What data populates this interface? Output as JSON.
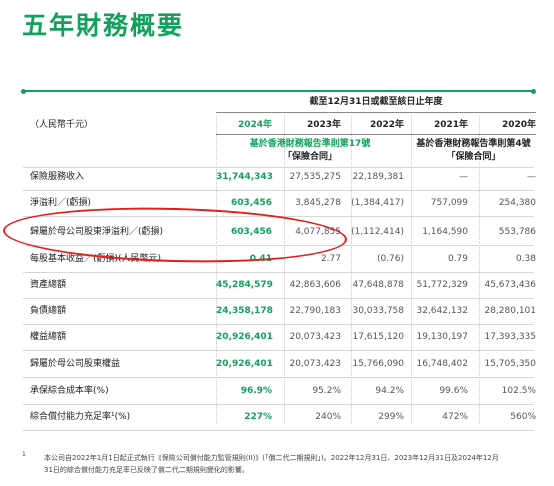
{
  "page": {
    "title": "五年財務概要"
  },
  "table": {
    "period_header": "截至12月31日或截至該日止年度",
    "unit_label": "（人民幣千元）",
    "years": [
      "2024年",
      "2023年",
      "2022年",
      "2021年",
      "2020年"
    ],
    "standard_17": "基於香港財務報告準則第17號\n「保險合同」",
    "standard_17_line1": "基於香港財務報告準則第17號",
    "standard_17_line2": "「保險合同」",
    "standard_4_line1": "基於香港財務報告準則第4號",
    "standard_4_line2": "「保險合同」",
    "rows": [
      {
        "label": "保險服務收入",
        "values": [
          "31,744,343",
          "27,535,275",
          "22,189,381",
          "—",
          "—"
        ]
      },
      {
        "label": "淨溢利／(虧損)",
        "values": [
          "603,456",
          "3,845,278",
          "(1,384,417)",
          "757,099",
          "254,380"
        ]
      },
      {
        "label": "歸屬於母公司股東淨溢利／(虧損)",
        "values": [
          "603,456",
          "4,077,855",
          "(1,112,414)",
          "1,164,590",
          "553,786"
        ]
      },
      {
        "label": "每股基本收益／(虧損)(人民幣元)",
        "values": [
          "0.41",
          "2.77",
          "(0.76)",
          "0.79",
          "0.38"
        ]
      },
      {
        "label": "資產總額",
        "values": [
          "45,284,579",
          "42,863,606",
          "47,648,878",
          "51,772,329",
          "45,673,436"
        ]
      },
      {
        "label": "負債總額",
        "values": [
          "24,358,178",
          "22,790,183",
          "30,033,758",
          "32,642,132",
          "28,280,101"
        ]
      },
      {
        "label": "權益總額",
        "values": [
          "20,926,401",
          "20,073,423",
          "17,615,120",
          "19,130,197",
          "17,393,335"
        ]
      },
      {
        "label": "歸屬於母公司股東權益",
        "values": [
          "20,926,401",
          "20,073,423",
          "15,766,090",
          "16,748,402",
          "15,705,350"
        ]
      },
      {
        "label": "承保綜合成本率(%)",
        "values": [
          "96.9%",
          "95.2%",
          "94.2%",
          "99.6%",
          "102.5%"
        ]
      },
      {
        "label": "綜合償付能力充足率¹(%)",
        "values": [
          "227%",
          "240%",
          "299%",
          "472%",
          "560%"
        ]
      }
    ]
  },
  "footnote": {
    "mark": "1",
    "line1": "本公司自2022年1月1日起正式執行《保險公司償付能力監管規則(II)》(「償二代二期規則」)。2022年12月31日、2023年12月31日及2024年12月",
    "line2": "31日的綜合償付能力充足率已反映了償二代二期規則變化的影響。"
  },
  "colors": {
    "brand_green": "#12a05c",
    "annotation_red": "#e0201c"
  }
}
